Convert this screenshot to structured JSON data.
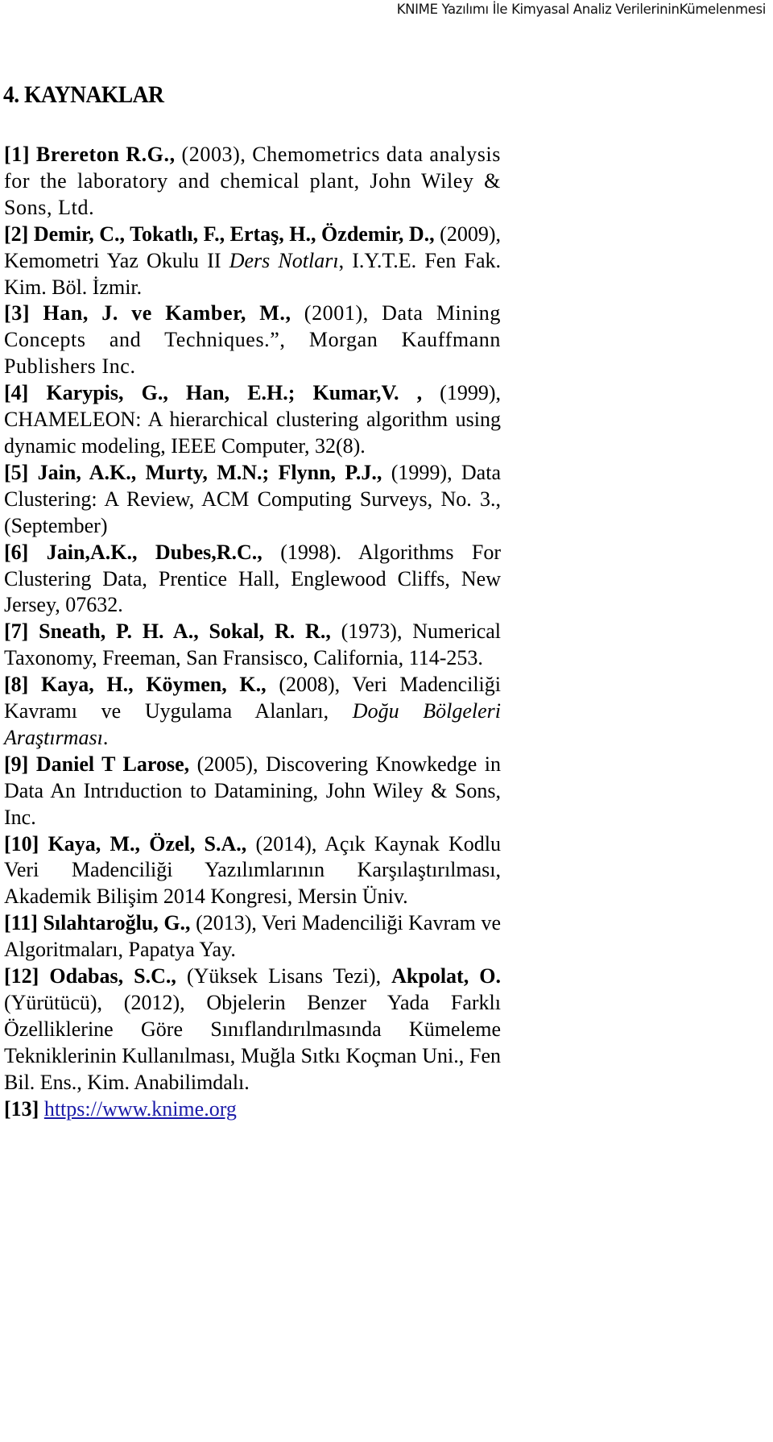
{
  "header": {
    "running_title": "KNIME Yazılımı İle Kimyasal Analiz VerilerininKümelenmesi"
  },
  "section": {
    "title": "4. KAYNAKLAR"
  },
  "references": [
    {
      "number": "[1]",
      "authors": "Brereton R.G.,",
      "text": " (2003), Chemometrics data analysis for the laboratory and chemical plant, John Wiley & Sons, Ltd."
    },
    {
      "number": "[2]",
      "authors": "Demir, C., Tokatlı, F., Ertaş, H., Özdemir, D.,",
      "text": " (2009), Kemometri Yaz Okulu II ",
      "italic": "Ders Notları",
      "text2": ", I.Y.T.E. Fen Fak. Kim. Böl. İzmir."
    },
    {
      "number": "[3]",
      "authors": "Han, J. ve Kamber, M.,",
      "text": " (2001), Data Mining Concepts and Techniques.”, Morgan Kauffmann Publishers Inc."
    },
    {
      "number": "[4]",
      "authors": "Karypis, G., Han, E.H.; Kumar,V. ,",
      "text": " (1999), CHAMELEON: A hierarchical clustering algorithm using dynamic modeling, IEEE Computer, 32(8)."
    },
    {
      "number": "[5]",
      "authors": "Jain, A.K., Murty, M.N.; Flynn, P.J.,",
      "text": " (1999), Data Clustering: A Review, ACM Computing Surveys, No. 3., (September)"
    },
    {
      "number": "[6]",
      "authors": "Jain,A.K., Dubes,R.C.,",
      "text": " (1998). Algorithms For Clustering Data, Prentice Hall, Englewood Cliffs, New Jersey, 07632."
    },
    {
      "number": "[7]",
      "authors": "Sneath, P. H. A., Sokal, R. R.,",
      "text": " (1973), Numerical Taxonomy, Freeman, San Fransisco, California, 114-253."
    },
    {
      "number": "[8]",
      "authors": "Kaya, H., Köymen, K.,",
      "text": " (2008), Veri Madenciliği Kavramı ve Uygulama Alanları, ",
      "italic": "Doğu Bölgeleri Araştırması",
      "text2": "."
    },
    {
      "number": "[9]",
      "authors": "Daniel T Larose,",
      "text": " (2005), Discovering Knowkedge in Data An Intrıduction to Datamining, John Wiley & Sons, Inc."
    },
    {
      "number": "[10]",
      "authors": "Kaya, M., Özel, S.A.,",
      "text": " (2014), Açık Kaynak Kodlu Veri Madenciliği Yazılımlarının Karşılaştırılması, Akademik Bilişim 2014 Kongresi, Mersin Üniv."
    },
    {
      "number": "[11]",
      "authors": "Sılahtaroğlu, G.,",
      "text": " (2013), Veri Madenciliği Kavram ve Algoritmaları, Papatya Yay."
    },
    {
      "number": "[12]",
      "authors": "Odabas, S.C.,",
      "text": " (Yüksek Lisans Tezi), ",
      "authors2": "Akpolat, O.",
      "text2": " (Yürütücü), (2012), Objelerin Benzer Yada Farklı Özelliklerine Göre Sınıflandırılmasında Kümeleme Tekniklerinin Kullanılması, Muğla Sıtkı Koçman Uni., Fen Bil. Ens., Kim. Anabilimdalı."
    },
    {
      "number": "[13]",
      "link": "https://www.knime.org"
    }
  ],
  "colors": {
    "link": "#1a1aa8",
    "text": "#000000"
  }
}
